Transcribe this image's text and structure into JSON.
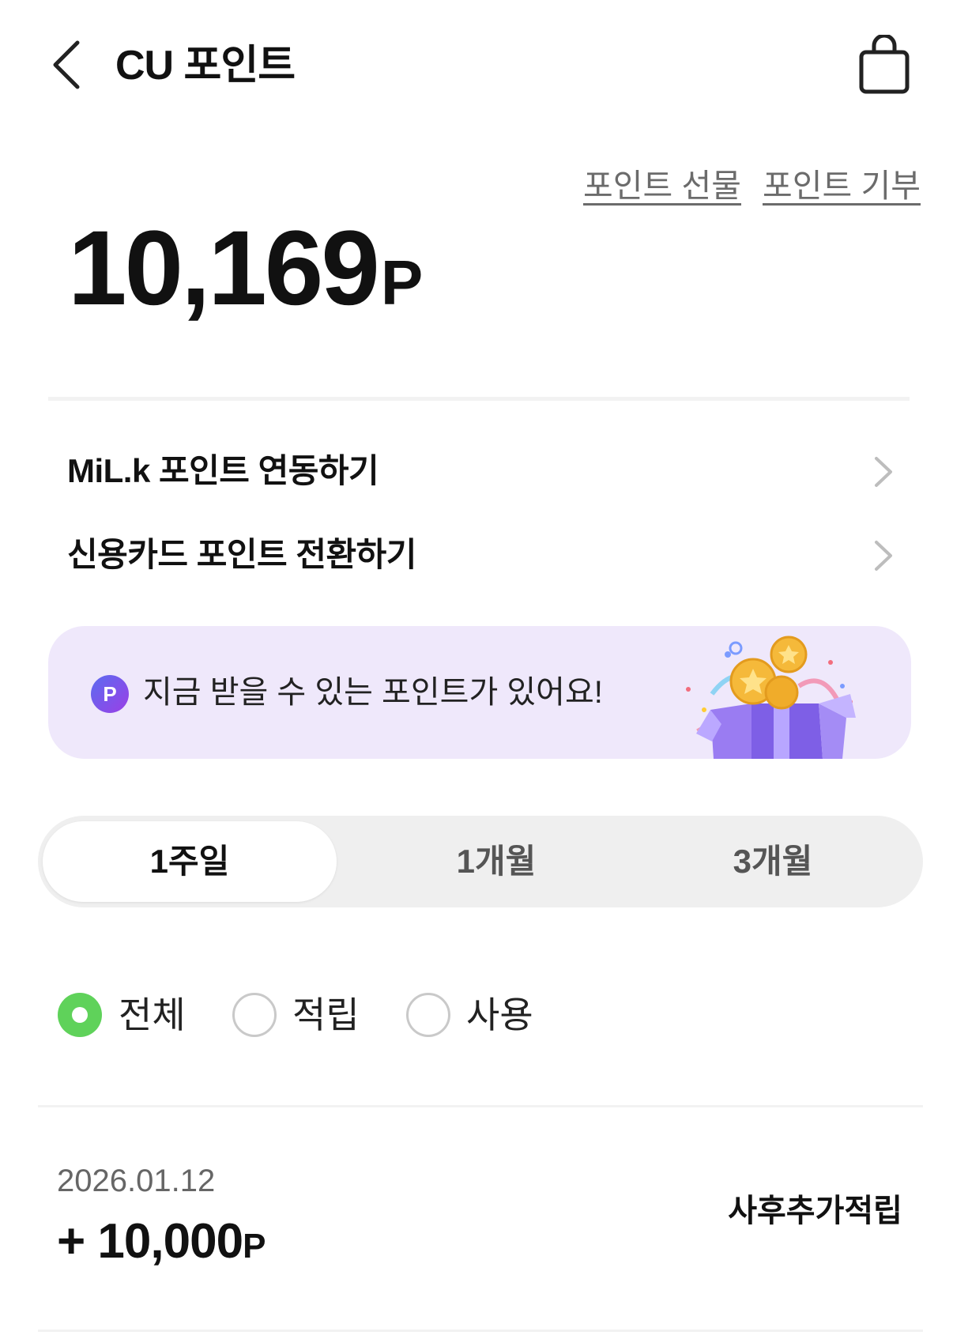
{
  "header": {
    "title": "CU 포인트",
    "back_icon": "chevron-left-icon",
    "bag_icon": "shopping-bag-icon"
  },
  "links": {
    "gift": "포인트 선물",
    "donate": "포인트 기부"
  },
  "balance": {
    "amount": "10,169",
    "unit": "P"
  },
  "menu": [
    {
      "label": "MiL.k 포인트 연동하기"
    },
    {
      "label": "신용카드 포인트 전환하기"
    }
  ],
  "banner": {
    "badge": "P",
    "text": "지금 받을 수 있는 포인트가 있어요!",
    "background": "#efe8fb"
  },
  "period_tabs": {
    "items": [
      "1주일",
      "1개월",
      "3개월"
    ],
    "selected": "1주일"
  },
  "filters": {
    "items": [
      "전체",
      "적립",
      "사용"
    ],
    "selected": "전체",
    "accent": "#5fd25a"
  },
  "history": [
    {
      "date": "2026.01.12",
      "amount": "+ 10,000",
      "unit": "P",
      "type": "사후추가적립"
    }
  ]
}
